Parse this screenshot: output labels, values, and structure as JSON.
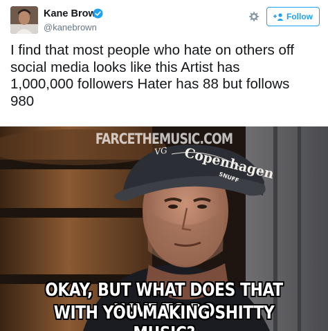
{
  "header": {
    "display_name": "Kane Brown",
    "handle": "@kanebrown",
    "verified": true,
    "follow_label": "Follow",
    "accent_color": "#1da1f2"
  },
  "tweet": {
    "text": "I find that most people who hate on others off\nsocial media looks like this   Artist has\n1,000,000 followers    Hater has 88 but follows\n980"
  },
  "meme": {
    "watermark": "FARCETHEMUSIC.COM",
    "hat_text": "Copenhagen",
    "hat_subtext": "SNUFF",
    "caption_line1": "OKAY, BUT WHAT DOES THAT HAVE TO DO",
    "caption_line2": "WITH YOU MAKING SHITTY MUSIC?"
  },
  "icons": {
    "gear": "gear-icon",
    "verified": "verified-badge-icon",
    "follow": "add-user-icon"
  }
}
